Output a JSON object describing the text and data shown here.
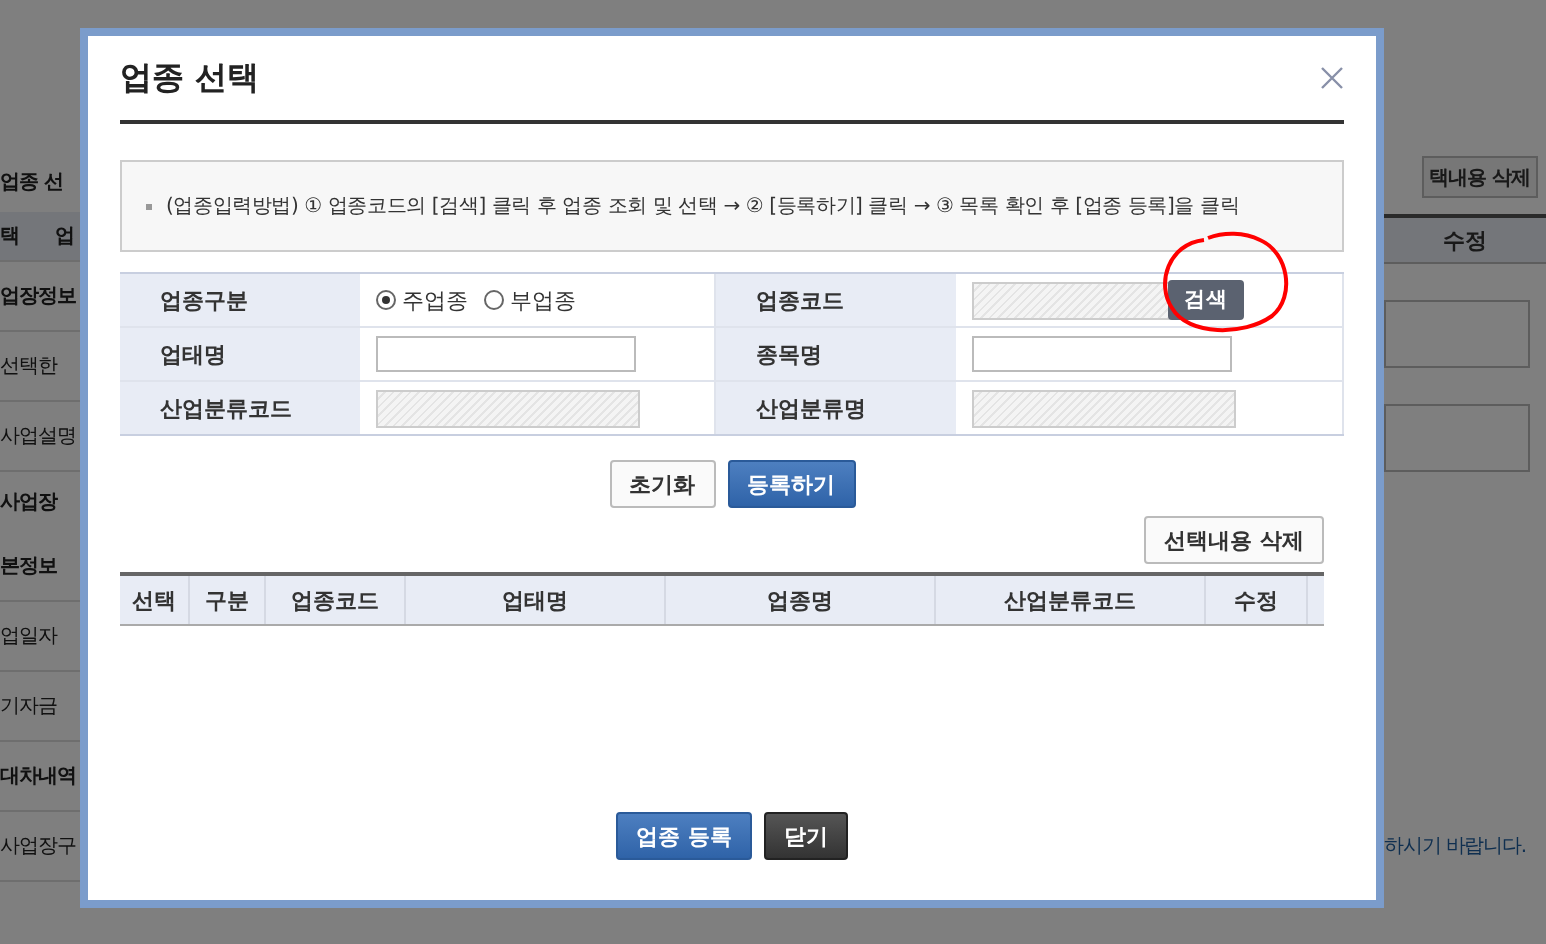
{
  "background": {
    "left": [
      {
        "kind": "heading",
        "text": "업종 선"
      },
      {
        "kind": "header",
        "text": "택",
        "extra": "업"
      },
      {
        "kind": "bold",
        "text": "업장정보"
      },
      {
        "kind": "plain",
        "text": "선택한"
      },
      {
        "kind": "plain",
        "text": "사업설명"
      },
      {
        "kind": "heading",
        "text": "사업장"
      },
      {
        "kind": "bold",
        "text": "본정보"
      },
      {
        "kind": "plain",
        "text": "업일자"
      },
      {
        "kind": "plain",
        "text": "기자금"
      },
      {
        "kind": "bold",
        "text": "대차내역"
      },
      {
        "kind": "plain",
        "text": "사업장구"
      }
    ],
    "right": {
      "button": "택내용 삭제",
      "column": "수정",
      "notice": "하시기 바랍니다."
    }
  },
  "modal": {
    "title": "업종 선택",
    "instruction": "(업종입력방법) ① 업종코드의 [검색] 클릭 후 업종 조회 및 선택 → ② [등록하기] 클릭 → ③ 목록 확인 후 [업종 등록]을 클릭",
    "form": [
      [
        {
          "label": "업종구분",
          "kind": "radio",
          "options": [
            {
              "label": "주업종",
              "selected": true
            },
            {
              "label": "부업종",
              "selected": false
            }
          ]
        },
        {
          "label": "업종코드",
          "kind": "search",
          "button": "검색"
        }
      ],
      [
        {
          "label": "업태명",
          "kind": "input"
        },
        {
          "label": "종목명",
          "kind": "input"
        }
      ],
      [
        {
          "label": "산업분류코드",
          "kind": "readonly"
        },
        {
          "label": "산업분류명",
          "kind": "readonly"
        }
      ]
    ],
    "form_buttons": [
      {
        "label": "초기화",
        "kind": "plain"
      },
      {
        "label": "등록하기",
        "kind": "primary"
      }
    ],
    "delete_button": "선택내용 삭제",
    "table": {
      "columns": [
        "선택",
        "구분",
        "업종코드",
        "업태명",
        "업종명",
        "산업분류코드",
        "수정"
      ]
    },
    "footer_buttons": [
      {
        "label": "업종 등록",
        "kind": "primary"
      },
      {
        "label": "닫기",
        "kind": "dark"
      }
    ]
  }
}
